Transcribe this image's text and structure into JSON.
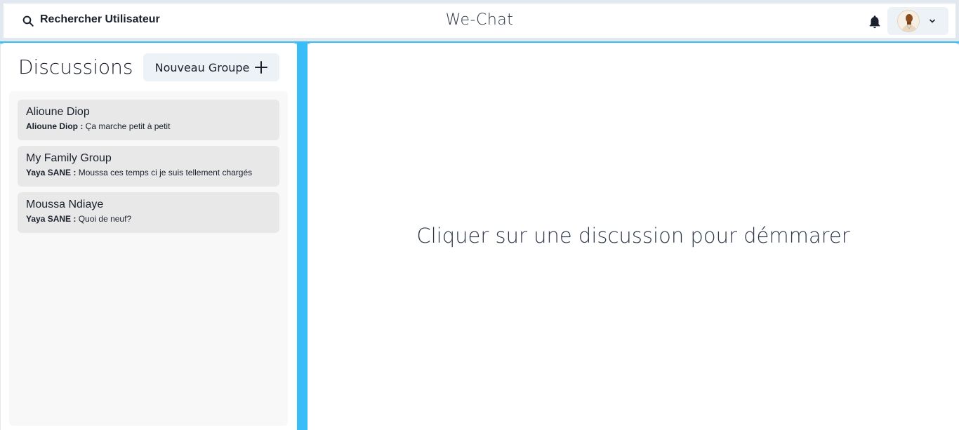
{
  "header": {
    "search_label": "Rechercher Utilisateur",
    "app_title": "We-Chat"
  },
  "sidebar": {
    "title": "Discussions",
    "new_group_label": "Nouveau Groupe",
    "chats": [
      {
        "name": "Alioune Diop",
        "sender": "Alioune Diop :",
        "message": "Ça marche petit à petit"
      },
      {
        "name": "My Family Group",
        "sender": "Yaya SANE :",
        "message": "Moussa ces temps ci je suis tellement chargés"
      },
      {
        "name": "Moussa Ndiaye",
        "sender": "Yaya SANE :",
        "message": "Quoi de neuf?"
      }
    ]
  },
  "main": {
    "placeholder": "Cliquer sur une discussion pour démmarer"
  },
  "icons": {
    "search": "search-icon",
    "bell": "bell-icon",
    "chevron": "chevron-down-icon",
    "add": "plus-icon"
  },
  "colors": {
    "accent": "#38bdf8",
    "background": "#e2e8f0",
    "button_bg": "#edf2f7",
    "chat_item_bg": "#e8e8e8"
  }
}
